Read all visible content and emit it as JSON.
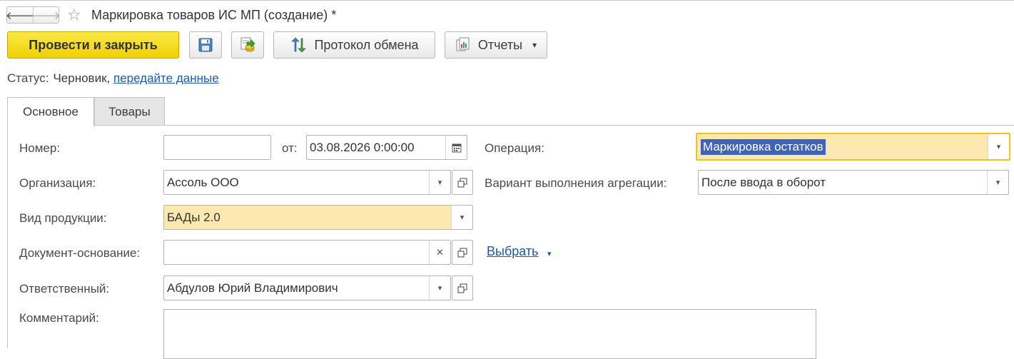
{
  "window": {
    "title": "Маркировка товаров ИС МП (создание) *",
    "nav_back": "🡐",
    "nav_forward": "🡒",
    "favorite": "☆"
  },
  "toolbar": {
    "post_close": "Провести и закрыть",
    "protocol": "Протокол обмена",
    "reports": "Отчеты",
    "dropdown_glyph": "▾"
  },
  "status": {
    "label": "Статус:",
    "value": "Черновик,",
    "link": "передайте данные"
  },
  "tabs": [
    {
      "label": "Основное",
      "active": true
    },
    {
      "label": "Товары",
      "active": false
    }
  ],
  "form": {
    "number": {
      "label": "Номер:",
      "value": ""
    },
    "date": {
      "label": "от:",
      "value": "03.08.2026  0:00:00"
    },
    "organization": {
      "label": "Организация:",
      "value": "Ассоль ООО"
    },
    "product_type": {
      "label": "Вид продукции:",
      "value": "БАДы 2.0"
    },
    "base_document": {
      "label": "Документ-основание:",
      "value": "",
      "select_link": "Выбрать"
    },
    "responsible": {
      "label": "Ответственный:",
      "value": "Абдулов Юрий Владимирович"
    },
    "comment": {
      "label": "Комментарий:",
      "value": ""
    },
    "operation": {
      "label": "Операция:",
      "value": "Маркировка остатков"
    },
    "aggregation": {
      "label": "Вариант выполнения агрегации:",
      "value": "После ввода в оборот"
    }
  },
  "glyphs": {
    "dropdown": "▾",
    "clear": "✕"
  },
  "colors": {
    "primary_button": "#f4d81a",
    "required_field": "#fde8b0",
    "focus_border": "#f4c21a",
    "link": "#1d5aa8",
    "selection": "#3f63b8"
  }
}
